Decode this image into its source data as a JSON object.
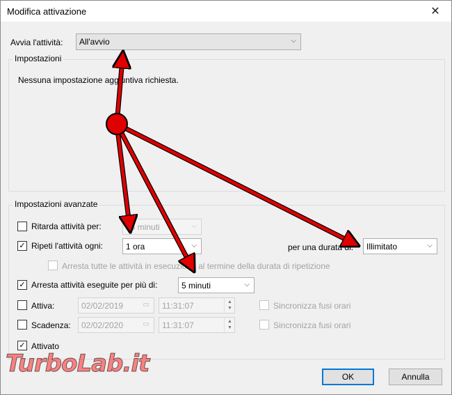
{
  "window": {
    "title": "Modifica attivazione",
    "close_glyph": "✕"
  },
  "trigger": {
    "label": "Avvia l'attività:",
    "value": "All'avvio"
  },
  "settings": {
    "title": "Impostazioni",
    "text": "Nessuna impostazione aggiuntiva richiesta."
  },
  "advanced": {
    "title": "Impostazioni avanzate",
    "delay": {
      "label": "Ritarda attività per:",
      "value": "15 minuti",
      "checked": false
    },
    "repeat": {
      "label": "Ripeti l'attività ogni:",
      "value": "1 ora",
      "checked": true,
      "duration_label": "per una durata di:",
      "duration_value": "Illimitato"
    },
    "stop_all": {
      "label": "Arresta tutte le attività in esecuzione al termine della durata di ripetizione",
      "checked": false
    },
    "stop_longer": {
      "label": "Arresta attività eseguite per più di:",
      "value": "5 minuti",
      "checked": true
    },
    "activate": {
      "label": "Attiva:",
      "date": "02/02/2019",
      "time": "11:31:07",
      "sync": "Sincronizza fusi orari",
      "checked": false
    },
    "expire": {
      "label": "Scadenza:",
      "date": "02/02/2020",
      "time": "11:31:07",
      "sync": "Sincronizza fusi orari",
      "checked": false
    },
    "enabled": {
      "label": "Attivato",
      "checked": true
    }
  },
  "buttons": {
    "ok": "OK",
    "cancel": "Annulla"
  },
  "watermark": {
    "text": "TurboLab.it"
  },
  "colors": {
    "accent": "#0078d7",
    "annotation": "#e00000",
    "annotation_outline": "#000000"
  }
}
